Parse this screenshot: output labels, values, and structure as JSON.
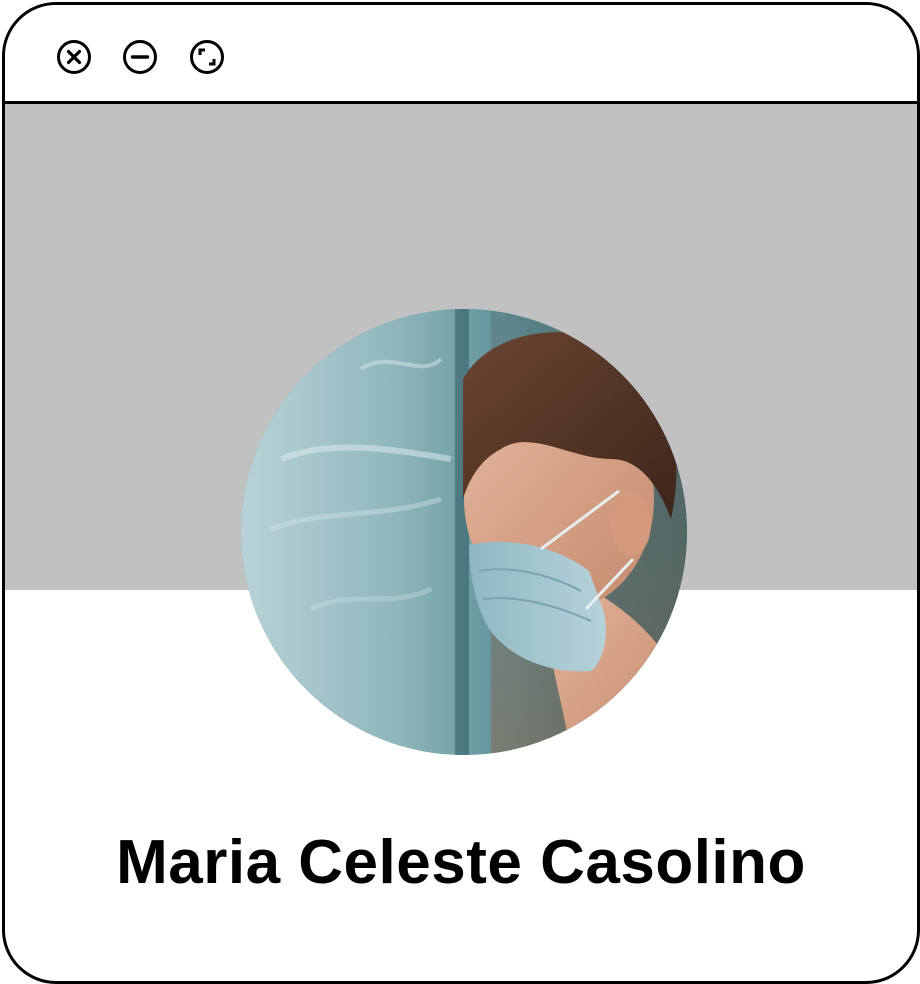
{
  "window": {
    "controls": {
      "close_icon": "close-icon",
      "minimize_icon": "minimize-icon",
      "maximize_icon": "maximize-icon"
    }
  },
  "profile": {
    "name": "Maria Celeste Casolino",
    "banner_color": "#c2c1c2"
  }
}
